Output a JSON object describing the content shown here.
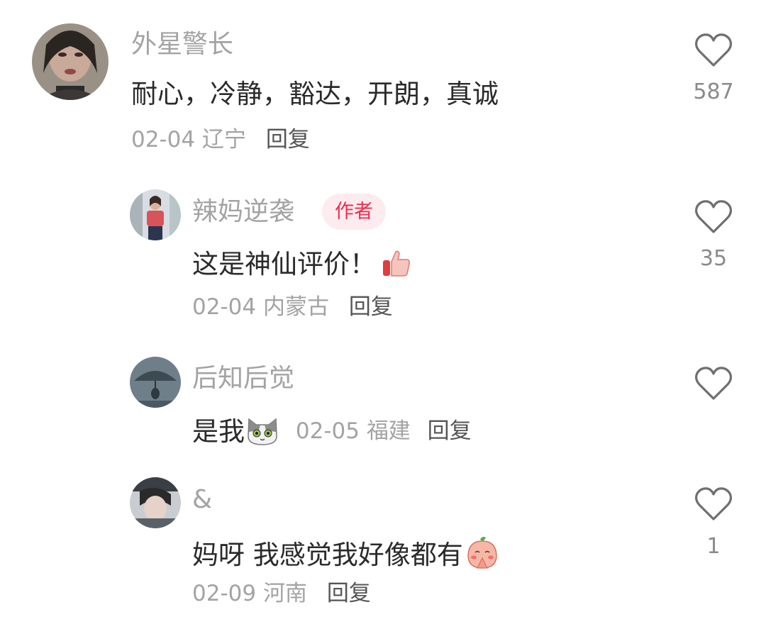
{
  "comments": [
    {
      "username": "外星警长",
      "text": "耐心，冷静，豁达，开朗，真诚",
      "date": "02-04",
      "location": "辽宁",
      "reply_label": "回复",
      "likes": "587"
    },
    {
      "username": "辣妈逆袭",
      "badge": "作者",
      "text": "这是神仙评价！",
      "date": "02-04",
      "location": "内蒙古",
      "reply_label": "回复",
      "likes": "35"
    },
    {
      "username": "后知后觉",
      "text": "是我",
      "date": "02-05",
      "location": "福建",
      "reply_label": "回复",
      "likes": ""
    },
    {
      "username": "&",
      "text": "妈呀 我感觉我好像都有",
      "date": "02-09",
      "location": "河南",
      "reply_label": "回复",
      "likes": "1"
    }
  ],
  "icons": {
    "like": "heart-outline-icon",
    "thumbs_up": "thumbs-up-emoji",
    "cat": "cat-face-emoji",
    "peach": "peach-pray-emoji"
  },
  "colors": {
    "username": "#a3a3a3",
    "body_text": "#2a2a2a",
    "badge_bg": "#fdecef",
    "badge_text": "#ee2c4f",
    "reply": "#555555"
  }
}
